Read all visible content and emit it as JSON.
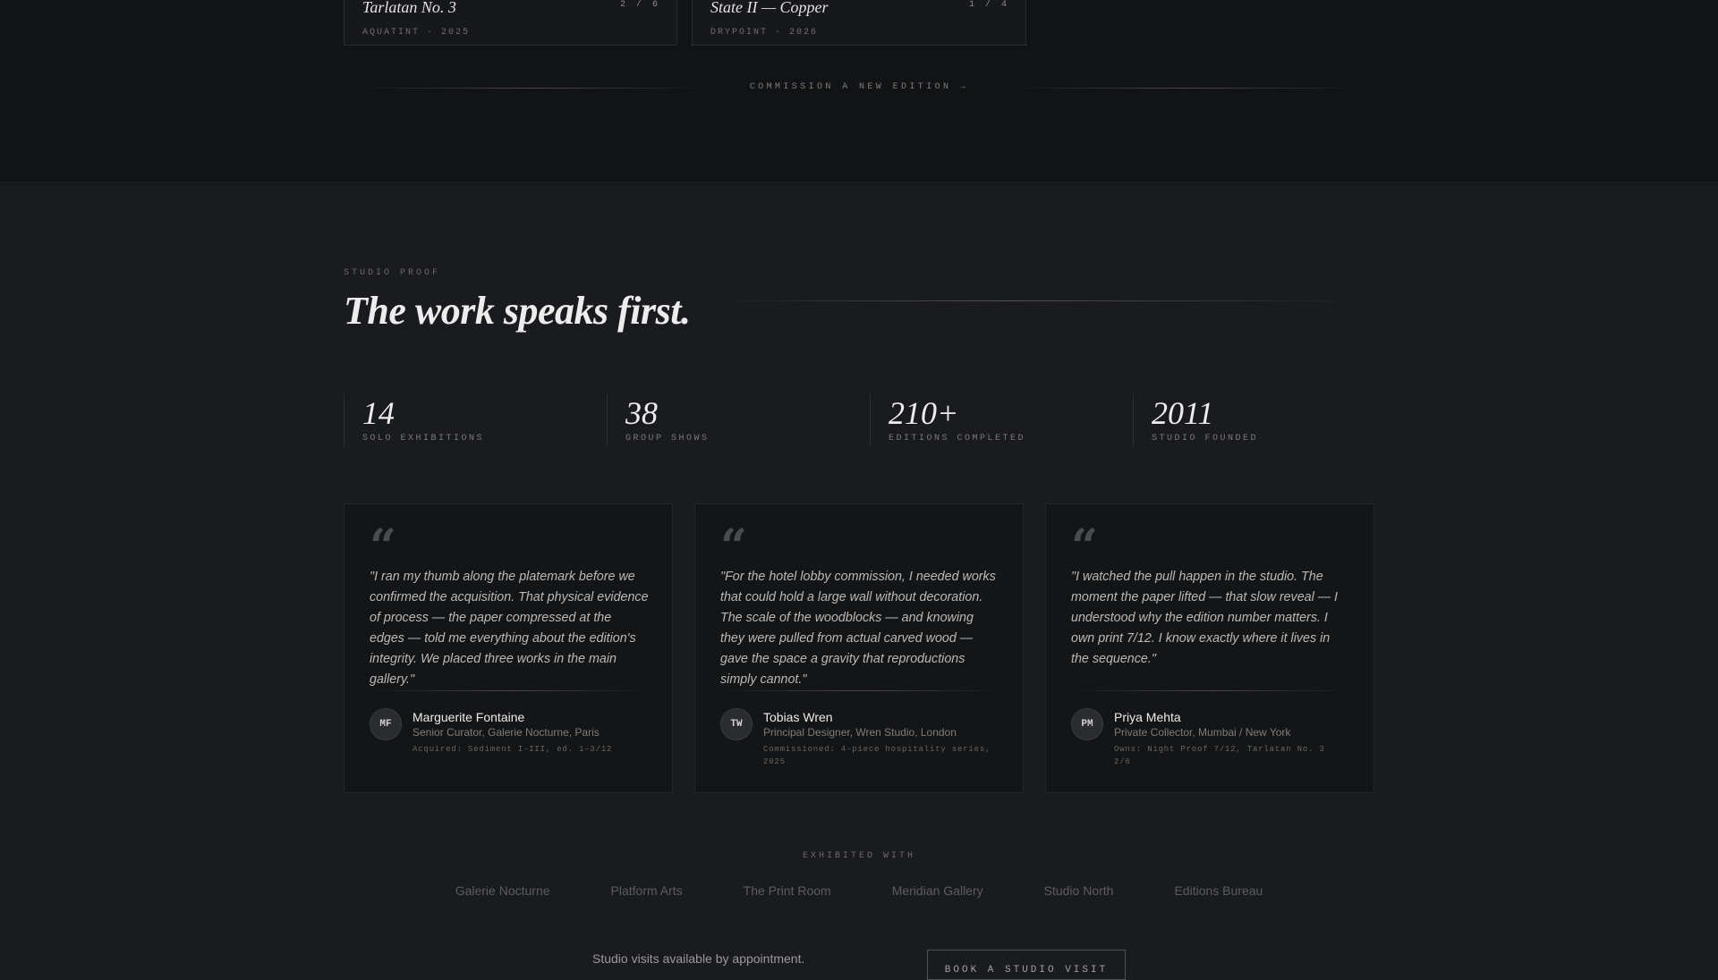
{
  "editions": [
    {
      "title": "Tarlatan No. 3",
      "count": "2 / 6",
      "meta": "AQUATINT · 2025"
    },
    {
      "title": "State II — Copper",
      "count": "1 / 4",
      "meta": "DRYPOINT · 2026"
    }
  ],
  "commission": {
    "label": "COMMISSION A NEW EDITION →"
  },
  "proof": {
    "eyebrow": "STUDIO PROOF",
    "title": "The work speaks first.",
    "stats": [
      {
        "value": "14",
        "label": "SOLO EXHIBITIONS"
      },
      {
        "value": "38",
        "label": "GROUP SHOWS"
      },
      {
        "value": "210+",
        "label": "EDITIONS COMPLETED"
      },
      {
        "value": "2011",
        "label": "STUDIO FOUNDED"
      }
    ],
    "testimonials": [
      {
        "quote": "\"I ran my thumb along the platemark before we confirmed the acquisition. That physical evidence of process — the paper compressed at the edges — told me everything about the edition's integrity. We placed three works in the main gallery.\"",
        "initials": "MF",
        "name": "Marguerite Fontaine",
        "role": "Senior Curator, Galerie Nocturne, Paris",
        "note": "Acquired: Sediment I–III, ed. 1–3/12"
      },
      {
        "quote": "\"For the hotel lobby commission, I needed works that could hold a large wall without decoration. The scale of the woodblocks — and knowing they were pulled from actual carved wood — gave the space a gravity that reproductions simply cannot.\"",
        "initials": "TW",
        "name": "Tobias Wren",
        "role": "Principal Designer, Wren Studio, London",
        "note": "Commissioned: 4-piece hospitality series, 2025"
      },
      {
        "quote": "\"I watched the pull happen in the studio. The moment the paper lifted — that slow reveal — I understood why the edition number matters. I own print 7/12. I know exactly where it lives in the sequence.\"",
        "initials": "PM",
        "name": "Priya Mehta",
        "role": "Private Collector, Mumbai / New York",
        "note": "Owns: Night Proof 7/12, Tarlatan No. 3 2/6"
      }
    ]
  },
  "exhibited": {
    "label": "EXHIBITED WITH",
    "venues": [
      "Galerie Nocturne",
      "Platform Arts",
      "The Print Room",
      "Meridian Gallery",
      "Studio North",
      "Editions Bureau"
    ]
  },
  "visit": {
    "note": "Studio visits available by appointment.",
    "button": "BOOK A STUDIO VISIT"
  }
}
